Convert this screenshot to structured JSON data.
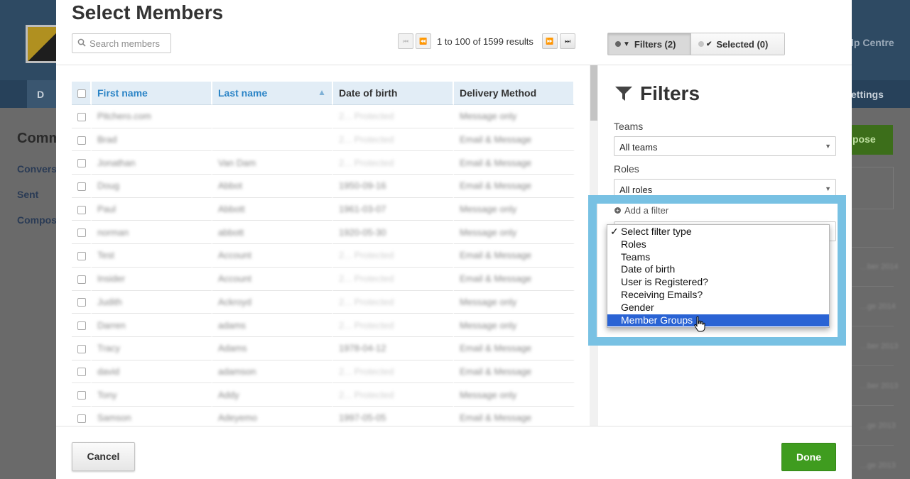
{
  "background": {
    "nav_left_label": "D",
    "help_label": "lp Centre",
    "settings_label": "ettings",
    "section_title": "Comm",
    "sidebar": [
      "Convers",
      "Sent",
      "Compos"
    ],
    "compose_label": "pose",
    "right_rows": [
      "…ber 2014",
      "…ge 2014",
      "…ber 2013",
      "…ber 2013",
      "…ge 2013",
      "…ge 2013"
    ]
  },
  "modal": {
    "title": "Select Members",
    "search": {
      "placeholder": "Search members",
      "value": ""
    },
    "pager": {
      "text": "1 to 100 of 1599 results"
    },
    "tabs": [
      {
        "label": "Filters (2)",
        "icon": "filter-icon",
        "active": true
      },
      {
        "label": "Selected (0)",
        "icon": "check-circle-icon",
        "active": false
      }
    ],
    "table": {
      "columns": [
        "First name",
        "Last name",
        "Date of birth",
        "Delivery Method"
      ],
      "sorted_column": "Last name",
      "rows": [
        [
          "Pitchero.com",
          "",
          "2... Protected",
          "Message only"
        ],
        [
          "Brad",
          "",
          "2... Protected",
          "Email & Message"
        ],
        [
          "Jonathan",
          "Van Dam",
          "2... Protected",
          "Email & Message"
        ],
        [
          "Doug",
          "Abbot",
          "1950-09-16",
          "Email & Message"
        ],
        [
          "Paul",
          "Abbott",
          "1961-03-07",
          "Message only"
        ],
        [
          "norman",
          "abbott",
          "1920-05-30",
          "Message only"
        ],
        [
          "Test",
          "Account",
          "2... Protected",
          "Email & Message"
        ],
        [
          "Insider",
          "Account",
          "2... Protected",
          "Email & Message"
        ],
        [
          "Judith",
          "Ackroyd",
          "2... Protected",
          "Message only"
        ],
        [
          "Darren",
          "adams",
          "2... Protected",
          "Message only"
        ],
        [
          "Tracy",
          "Adams",
          "1978-04-12",
          "Email & Message"
        ],
        [
          "david",
          "adamson",
          "2... Protected",
          "Email & Message"
        ],
        [
          "Tony",
          "Addy",
          "2... Protected",
          "Message only"
        ],
        [
          "Samson",
          "Adeyemo",
          "1997-05-05",
          "Email & Message"
        ]
      ]
    },
    "filters": {
      "title": "Filters",
      "teams_label": "Teams",
      "teams_value": "All teams",
      "roles_label": "Roles",
      "roles_value": "All roles",
      "add_filter_label": "Add a filter",
      "filter_type_options": [
        "Select filter type",
        "Roles",
        "Teams",
        "Date of birth",
        "User is Registered?",
        "Receiving Emails?",
        "Gender",
        "Member Groups"
      ],
      "checked_option": "Select filter type",
      "hovered_option": "Member Groups"
    },
    "buttons": {
      "cancel": "Cancel",
      "done": "Done"
    },
    "colors": {
      "accent_blue": "#2b84c6",
      "done_green": "#3f9c1f",
      "highlight": "#78c1e3",
      "menu_highlight": "#2a63d4"
    }
  }
}
